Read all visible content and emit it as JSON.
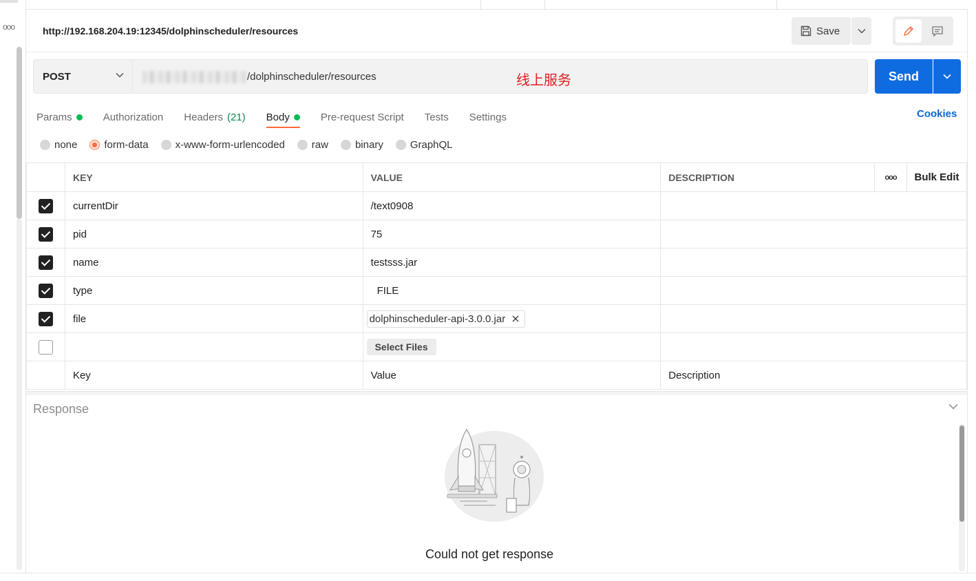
{
  "header": {
    "title": "http://192.168.204.19:12345/dolphinscheduler/resources",
    "save_label": "Save"
  },
  "request": {
    "method": "POST",
    "url_visible_part": "/dolphinscheduler/resources",
    "annotation": "线上服务",
    "send_label": "Send"
  },
  "tabs": [
    {
      "label": "Params",
      "dot": true
    },
    {
      "label": "Authorization"
    },
    {
      "label": "Headers",
      "count": "(21)"
    },
    {
      "label": "Body",
      "dot": true,
      "active": true
    },
    {
      "label": "Pre-request Script"
    },
    {
      "label": "Tests"
    },
    {
      "label": "Settings"
    }
  ],
  "cookies_label": "Cookies",
  "body_types": [
    "none",
    "form-data",
    "x-www-form-urlencoded",
    "raw",
    "binary",
    "GraphQL"
  ],
  "body_type_selected": "form-data",
  "table": {
    "headers": {
      "key": "KEY",
      "value": "VALUE",
      "description": "DESCRIPTION",
      "more": "ooo",
      "bulk_edit": "Bulk Edit"
    },
    "rows": [
      {
        "checked": true,
        "key": "currentDir",
        "value": "/text0908"
      },
      {
        "checked": true,
        "key": "pid",
        "value": "75"
      },
      {
        "checked": true,
        "key": "name",
        "value": "testsss.jar"
      },
      {
        "checked": true,
        "key": "type",
        "value": "FILE"
      },
      {
        "checked": true,
        "key": "file",
        "file": "dolphinscheduler-api-3.0.0.jar"
      },
      {
        "checked": false,
        "key": "",
        "select_files": "Select Files"
      }
    ],
    "placeholders": {
      "key": "Key",
      "value": "Value",
      "description": "Description"
    }
  },
  "response": {
    "title": "Response",
    "message": "Could not get response"
  },
  "sidebar": {
    "more": "ooo"
  },
  "colors": {
    "accent": "#ff6c37",
    "send": "#0f6ce0",
    "dot": "#0cbb52",
    "annotation": "#e02020",
    "link": "#0b66d8"
  }
}
